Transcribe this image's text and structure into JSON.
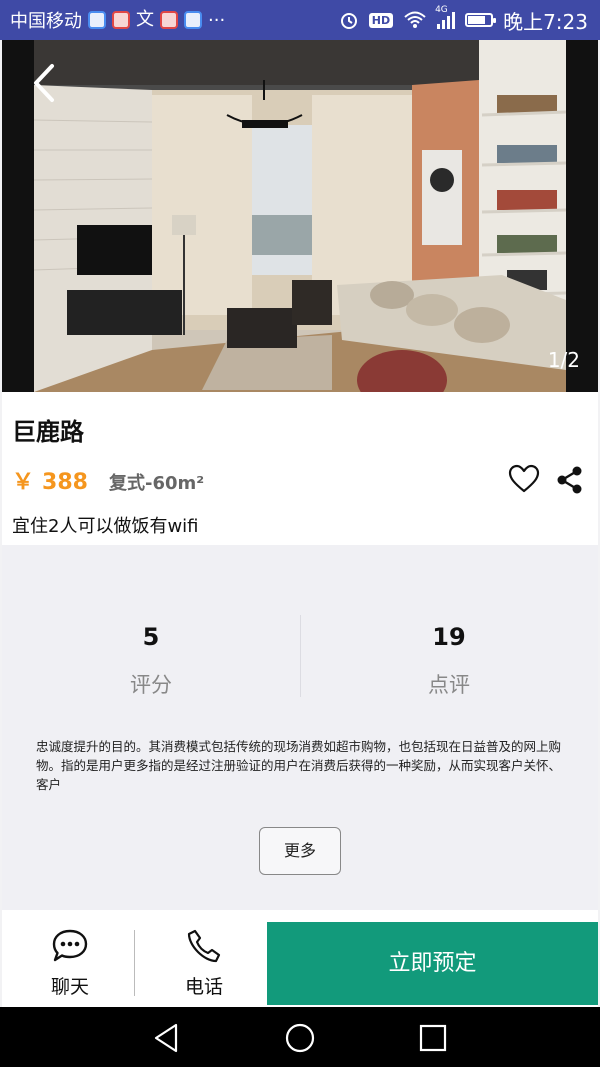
{
  "status_bar": {
    "carrier": "中国移动",
    "extra_glyph": "文",
    "more": "···",
    "hd": "HD",
    "network": "4G",
    "time": "晚上7:23",
    "battery_level": 0.75
  },
  "hero": {
    "image_counter": "1/2",
    "image_desc_icon": "living-room-photo"
  },
  "listing": {
    "title": "巨鹿路",
    "price_symbol": "￥",
    "price": "388",
    "unit_type": "复式-60m²",
    "short_desc": "宜住2人可以做饭有wifi"
  },
  "stats": [
    {
      "value": "5",
      "label": "评分"
    },
    {
      "value": "19",
      "label": "点评"
    }
  ],
  "long_desc": "忠诚度提升的目的。其消费模式包括传统的现场消费如超市购物，也包括现在日益普及的网上购物。指的是用户更多指的是经过注册验证的用户在消费后获得的一种奖励，从而实现客户关怀、客户",
  "more_label": "更多",
  "actions": {
    "chat_label": "聊天",
    "phone_label": "电话",
    "book_label": "立即预定"
  },
  "colors": {
    "status_bar": "#3f4aa6",
    "price": "#f5961e",
    "book_button": "#129a7b"
  }
}
